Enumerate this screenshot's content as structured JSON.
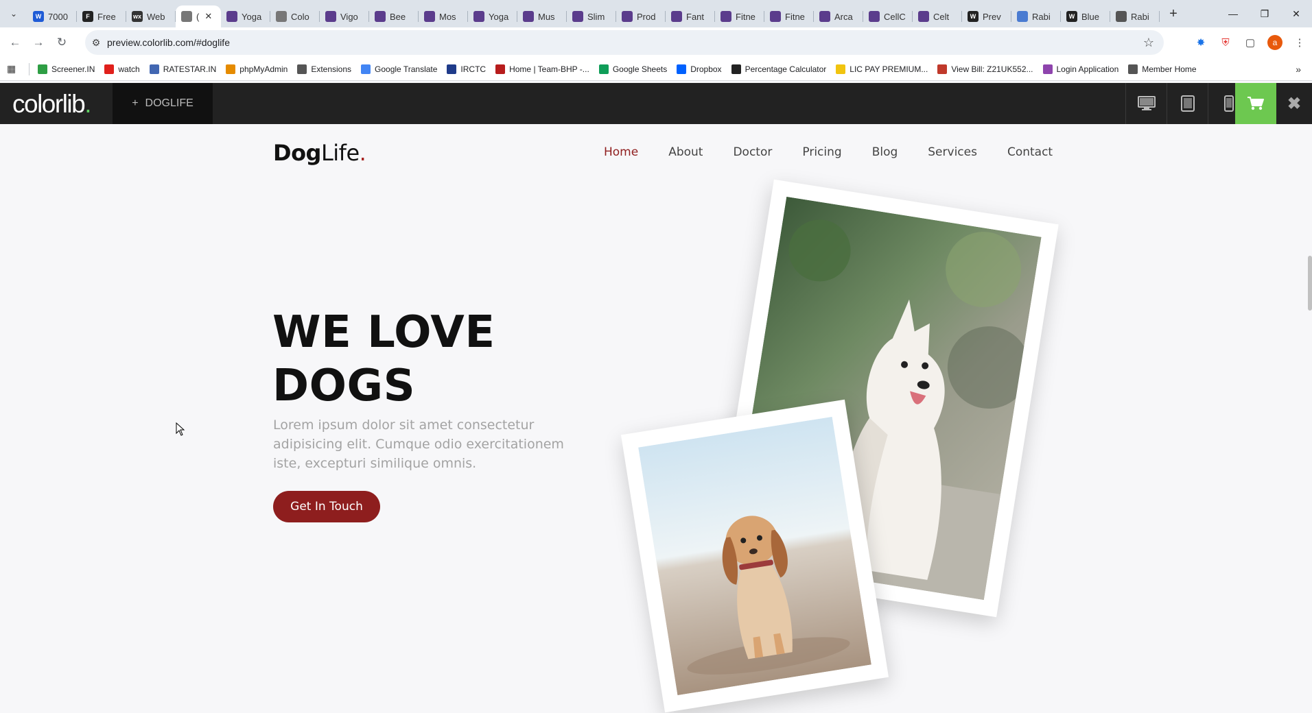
{
  "browser": {
    "tabs": [
      {
        "label": "7000",
        "fav": "W",
        "color": "#1e5bd6"
      },
      {
        "label": "Free",
        "fav": "F",
        "color": "#222222"
      },
      {
        "label": "Web",
        "fav": "wx",
        "color": "#333333"
      },
      {
        "label": "(",
        "fav": "",
        "color": "#777777",
        "active": true
      },
      {
        "label": "Yoga",
        "fav": "",
        "color": "#5b3c8c"
      },
      {
        "label": "Colo",
        "fav": "",
        "color": "#777777"
      },
      {
        "label": "Vigo",
        "fav": "",
        "color": "#5b3c8c"
      },
      {
        "label": "Bee",
        "fav": "",
        "color": "#5b3c8c"
      },
      {
        "label": "Mos",
        "fav": "",
        "color": "#5b3c8c"
      },
      {
        "label": "Yoga",
        "fav": "",
        "color": "#5b3c8c"
      },
      {
        "label": "Mus",
        "fav": "",
        "color": "#5b3c8c"
      },
      {
        "label": "Slim",
        "fav": "",
        "color": "#5b3c8c"
      },
      {
        "label": "Prod",
        "fav": "",
        "color": "#5b3c8c"
      },
      {
        "label": "Fant",
        "fav": "",
        "color": "#5b3c8c"
      },
      {
        "label": "Fitne",
        "fav": "",
        "color": "#5b3c8c"
      },
      {
        "label": "Fitne",
        "fav": "",
        "color": "#5b3c8c"
      },
      {
        "label": "Arca",
        "fav": "",
        "color": "#5b3c8c"
      },
      {
        "label": "CellC",
        "fav": "",
        "color": "#5b3c8c"
      },
      {
        "label": "Celt",
        "fav": "",
        "color": "#5b3c8c"
      },
      {
        "label": "Prev",
        "fav": "W",
        "color": "#222222"
      },
      {
        "label": "Rabi",
        "fav": "",
        "color": "#4a7bd1"
      },
      {
        "label": "Blue",
        "fav": "W",
        "color": "#222222"
      },
      {
        "label": "Rabi",
        "fav": "",
        "color": "#555555"
      }
    ],
    "url": "preview.colorlib.com/#doglife",
    "bookmarks": [
      {
        "label": "Screener.IN",
        "color": "#2e9e44"
      },
      {
        "label": "watch",
        "color": "#e0201b"
      },
      {
        "label": "RATESTAR.IN",
        "color": "#4267b2"
      },
      {
        "label": "phpMyAdmin",
        "color": "#e58b00"
      },
      {
        "label": "Extensions",
        "color": "#555555"
      },
      {
        "label": "Google Translate",
        "color": "#4285f4"
      },
      {
        "label": "IRCTC",
        "color": "#1f3b8a"
      },
      {
        "label": "Home | Team-BHP -...",
        "color": "#b71c1c"
      },
      {
        "label": "Google Sheets",
        "color": "#0f9d58"
      },
      {
        "label": "Dropbox",
        "color": "#0061fe"
      },
      {
        "label": "Percentage Calculator",
        "color": "#222222"
      },
      {
        "label": "LIC PAY PREMIUM...",
        "color": "#f1c40f"
      },
      {
        "label": "View Bill: Z21UK552...",
        "color": "#c0392b"
      },
      {
        "label": "Login Application",
        "color": "#8e44ad"
      },
      {
        "label": "Member Home",
        "color": "#555555"
      }
    ]
  },
  "colorlib": {
    "logo": "colorlib",
    "logo_dot": ".",
    "theme_plus": "+",
    "theme_name": "DOGLIFE",
    "close_glyph": "✖",
    "accent": "#6dc850"
  },
  "site": {
    "brand_bold": "Dog",
    "brand_rest": "Life",
    "brand_dot": ".",
    "nav": [
      {
        "label": "Home",
        "active": true
      },
      {
        "label": "About"
      },
      {
        "label": "Doctor"
      },
      {
        "label": "Pricing"
      },
      {
        "label": "Blog"
      },
      {
        "label": "Services"
      },
      {
        "label": "Contact"
      }
    ],
    "hero_line1": "WE LOVE",
    "hero_line2": "DOGS",
    "hero_text": "Lorem ipsum dolor sit amet consectetur adipisicing elit. Cumque odio exercitationem iste, excepturi similique omnis.",
    "cta": "Get In Touch",
    "accent": "#8e1e1e"
  }
}
